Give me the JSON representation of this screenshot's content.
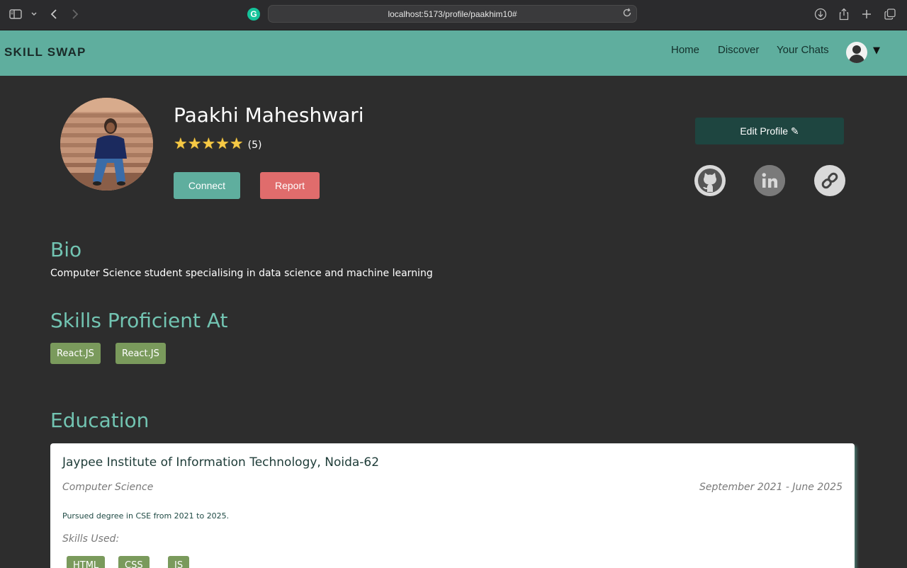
{
  "browser": {
    "url": "localhost:5173/profile/paakhim10#",
    "extension_badge": "G"
  },
  "navbar": {
    "brand": "SKILL SWAP",
    "links": [
      "Home",
      "Discover",
      "Your Chats"
    ],
    "dropdown_caret": "▼"
  },
  "profile": {
    "name": "Paakhi Maheshwari",
    "stars": "★★★★★",
    "rating_count": "(5)",
    "connect_label": "Connect",
    "report_label": "Report",
    "edit_label": "Edit Profile ✎",
    "social_icons": [
      "github-icon",
      "linkedin-icon",
      "link-icon"
    ]
  },
  "bio": {
    "heading": "Bio",
    "text": "Computer Science student specialising in data science and machine learning"
  },
  "skills": {
    "heading": "Skills Proficient At",
    "items": [
      "React.JS",
      "React.JS"
    ]
  },
  "education": {
    "heading": "Education",
    "entries": [
      {
        "institution": "Jaypee Institute of Information Technology, Noida-62",
        "field": "Computer Science",
        "dates": "September 2021 - June 2025",
        "description": "Pursued degree in CSE from 2021 to 2025.",
        "skills_label": "Skills Used:",
        "skills": [
          "HTML",
          "CSS",
          "JS"
        ]
      }
    ]
  },
  "colors": {
    "navbar": "#5fae9e",
    "accent_heading": "#72c4b2",
    "background": "#2d2d2d",
    "chip": "#7a9a5c",
    "report": "#e06c6c",
    "edit": "#1e4540"
  }
}
